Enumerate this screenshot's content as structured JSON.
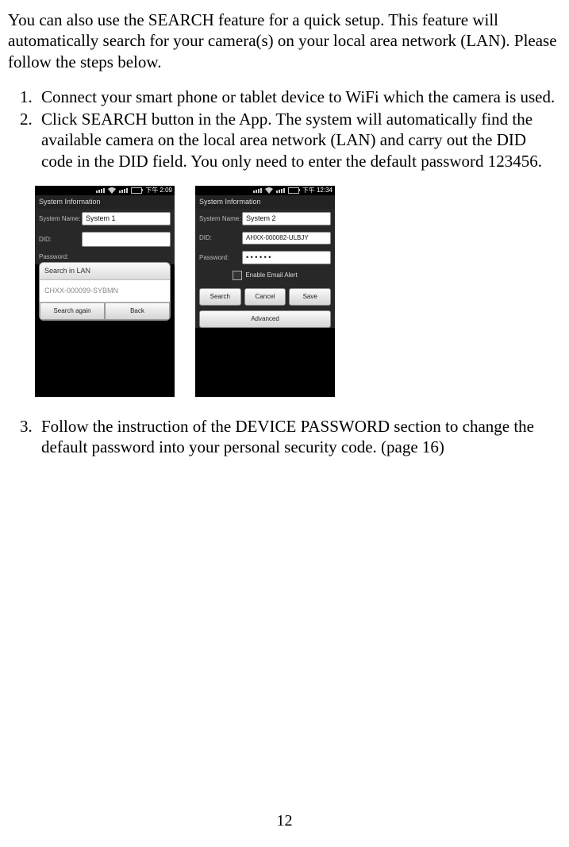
{
  "intro": "You can also use the SEARCH feature for a quick setup. This feature will automatically search for your camera(s) on your local area network (LAN). Please follow the steps below.",
  "steps": {
    "s1": "Connect your smart phone or tablet device to WiFi which the camera is used.",
    "s2": "Click SEARCH button in the App. The system will automatically find the available camera on the local area network (LAN) and carry out the DID code in the DID field. You only need to enter the default password 123456.",
    "s3": "Follow the instruction of the DEVICE PASSWORD section to change the default password into your personal security code. (page 16)"
  },
  "phone1": {
    "time": "下午 2:09",
    "section": "System Information",
    "label_name": "System Name:",
    "value_name": "System 1",
    "label_did": "DID:",
    "label_pw": "Password:",
    "popup_title": "Search in LAN",
    "popup_item": "CHXX-000099-SYBMN",
    "btn_search_again": "Search again",
    "btn_back": "Back"
  },
  "phone2": {
    "time": "下午 12:34",
    "section": "System Information",
    "label_name": "System Name:",
    "value_name": "System 2",
    "label_did": "DID:",
    "value_did": "AHXX-000082-ULBJY",
    "label_pw": "Password:",
    "value_pw": "• • • • • •",
    "cb_label": "Enable Email Alert",
    "btn_search": "Search",
    "btn_cancel": "Cancel",
    "btn_save": "Save",
    "btn_advanced": "Advanced"
  },
  "page_number": "12"
}
